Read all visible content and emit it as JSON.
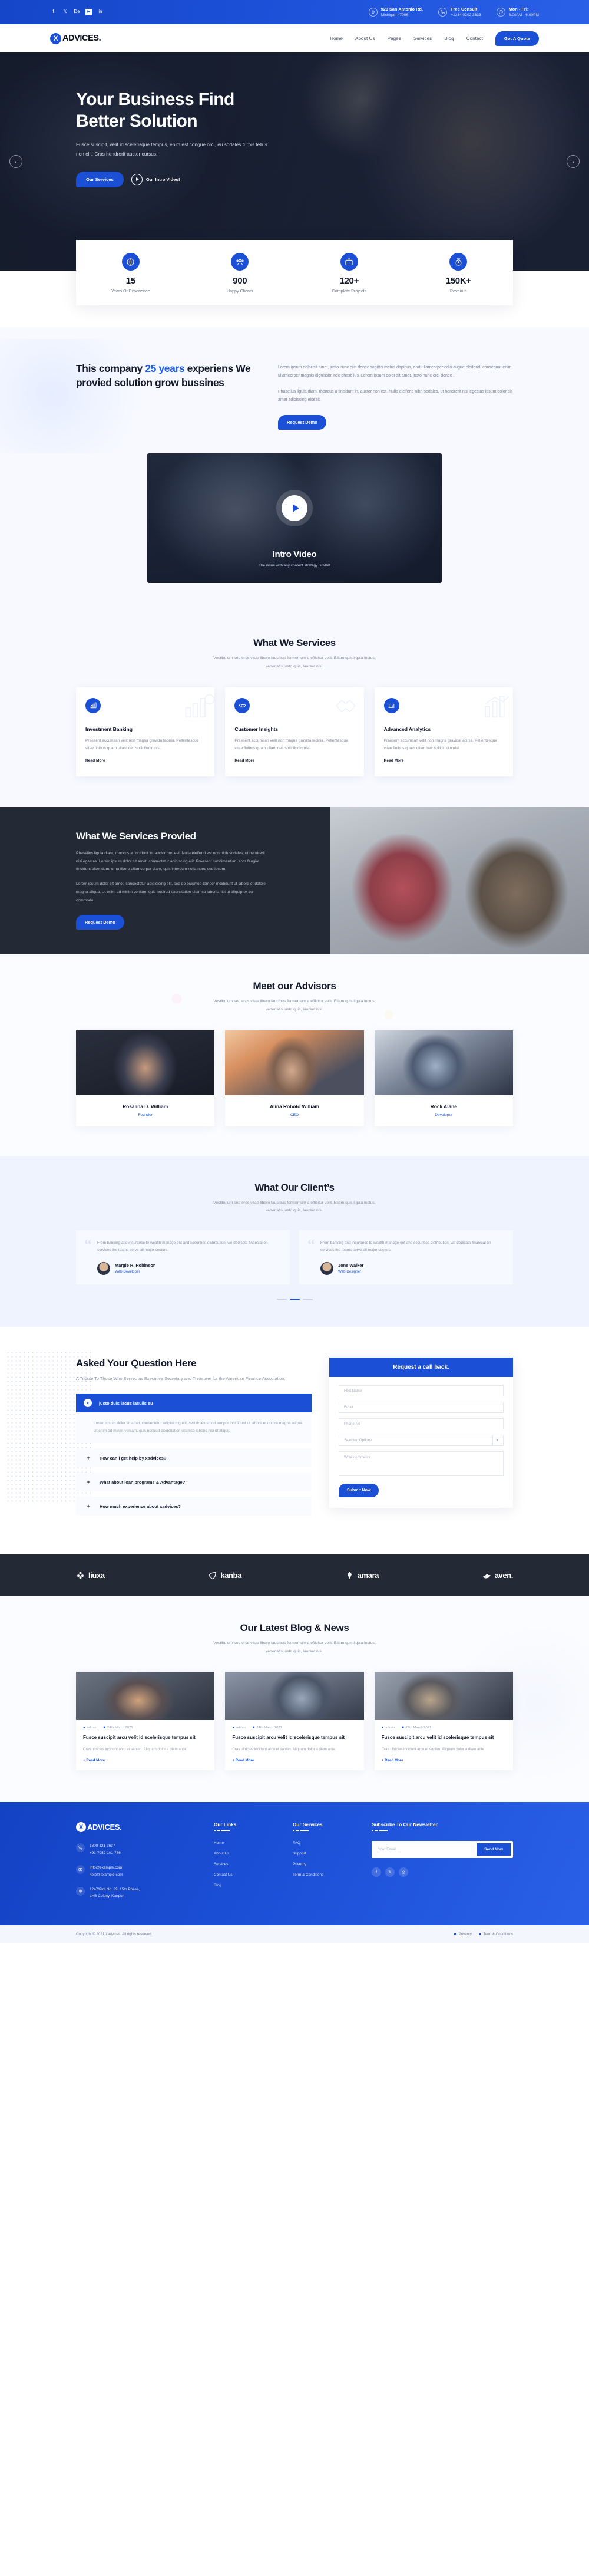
{
  "topbar": {
    "social": [
      "f",
      "t",
      "Dr",
      "yt",
      "in"
    ],
    "info": [
      {
        "icon": "location-pin-icon",
        "line1": "920 San Antonio Rd,",
        "line2": "Michigan 47096"
      },
      {
        "icon": "phone-icon",
        "line1": "Free Consult",
        "line2": "+1234 0202 3333"
      },
      {
        "icon": "clock-icon",
        "line1": "Mon - Fri:",
        "line2": "8:00AM - 6:00PM"
      }
    ]
  },
  "nav": {
    "logo_mark": "X",
    "logo_text": "ADVICES.",
    "items": [
      "Home",
      "About Us",
      "Pages",
      "Services",
      "Blog",
      "Contact"
    ],
    "cta": "Got A Quote"
  },
  "hero": {
    "title_line1": "Your Business Find",
    "title_line2": "Better Solution",
    "paragraph": "Fusce suscipit, velit id scelerisque tempus, enim est congue orci, eu sodales turpis tellus non elit. Cras hendrerit auctor cursus.",
    "primary_button": "Our Services",
    "video_label": "Our Intro Video!",
    "prev": "‹",
    "next": "›"
  },
  "stats": [
    {
      "icon": "globe-icon",
      "number": "15",
      "label": "Years Of Experience"
    },
    {
      "icon": "people-group-icon",
      "number": "900",
      "label": "Happy Clients"
    },
    {
      "icon": "briefcase-icon",
      "number": "120+",
      "label": "Complete Projects"
    },
    {
      "icon": "money-bag-icon",
      "number": "150K+",
      "label": "Revenue"
    }
  ],
  "about": {
    "title_pre": "This company ",
    "title_accent": "25 years",
    "title_post": " experiens We provied solution grow bussines",
    "p1": "Lorem ipsum dolor sit amet, justo nunc orci donec sagittis metus dapibus, erat ullamcorper odio augue eleifend, consequat enim ullamcorper magnis dignissim nec phasellus, Lorem ipsum dolor sit amet, justo nunc orci donec .",
    "p2": "Phasellus ligula diam, rhoncus a tincidunt in, auctor non est. Nulla eleifend nibh sodales, ut hendrerit nisi egestas ipsum dolor sit amet adipiscing elseait.",
    "button": "Request Demo"
  },
  "video": {
    "title": "Intro Video",
    "caption": "The issue with any content strategy is what",
    "play": "play-icon"
  },
  "services": {
    "heading": "What We Services",
    "sub": "Vestibulum sed eros vitae libero faucibus fermentum a efficitur velit. Etiam quis ligula luctus, venenatis justo quis, laoreet nisl.",
    "cards": [
      {
        "icon": "chart-money-icon",
        "title": "Investment Banking",
        "text": "Praesent accumsan velit non magna gravida lacinia. Pellentesque vitae finibus quam ullam nec sollicitudin nisi.",
        "link": "Read More"
      },
      {
        "icon": "handshake-icon",
        "title": "Customer Insights",
        "text": "Praesent accumsan velit non magna gravida lacinia. Pellentesque vitae finibus quam ullam nec sollicitudin nisi.",
        "link": "Read More"
      },
      {
        "icon": "bar-chart-icon",
        "title": "Advanced Analytics",
        "text": "Praesent accumsan velit non magna gravida lacinia. Pellentesque vitae finibus quam ullam nec sollicitudin nisi.",
        "link": "Read More"
      }
    ]
  },
  "provied": {
    "title": "What We Services Provied",
    "p1": "Phasellus ligula diam, rhoncus a tincidunt in, auctor non est. Nulla eleifend est non nibh sodales, ut hendrerit nisi egestas. Lorem ipsum dolor sit amet, consectetur adipiscing elit. Praesent condimentum, eros feugiat tincidunt bibendum, urna libero ullamcorper diam, quis interdum nulla nunc sed ipsum.",
    "p2": "Lorem ipsum dolor sit amet, consectetur adipisicing elit, sed do eiusmod tempor incididunt ut labore et dolore magna aliqua. Ut enim ad minim veniam, quis nostrud exercitation ullamco laboris nisi ut aliquip ex ea commodo.",
    "button": "Request Demo"
  },
  "advisors": {
    "heading": "Meet our Advisors",
    "sub": "Vestibulum sed eros vitae libero faucibus fermentum a efficitur velit. Etiam quis ligula luctus, venenatis justo quis, laoreet nisl.",
    "people": [
      {
        "name": "Rosalina D. William",
        "role": "Founder"
      },
      {
        "name": "Alina Roboto William",
        "role": "CEO"
      },
      {
        "name": "Rock Alane",
        "role": "Developer"
      }
    ]
  },
  "testimonials": {
    "heading": "What Our Client’s",
    "sub": "Vestibulum sed eros vitae libero faucibus fermentum a efficitur velit. Etiam quis ligula luctus, venenatis justo quis, laoreet nisl.",
    "items": [
      {
        "quote": "From banking and insurance to wealth manage ent and securities distribution, we dedicate financial on services the teams serve all major sectors.",
        "name": "Margie R. Robinson",
        "role": "Web Developer"
      },
      {
        "quote": "From banking and insurance to wealth manage ent and securities distribution, we dedicate financial on services the teams serve all major sectors.",
        "name": "Jone Walker",
        "role": "Web Designer"
      }
    ],
    "dots": 3,
    "active_dot": 1
  },
  "faq": {
    "heading": "Asked Your Question Here",
    "sub": "A Tribute To Those Who Served as Executive Secretary and Treasurer for the American Finance Association.",
    "open": {
      "icon": "close-icon",
      "title": "justo duis lacus iaculis eu",
      "body": "Lorem ipsum dolor sit amet, consectetur adipisicing elit, sed do eiusmod tempor incididunt ut labore et dolore magna aliqua. Ut enim ad minim veniam, quis nostrud exercitation ullamco laboris nisi ut aliquip"
    },
    "closed": [
      {
        "icon": "plus-icon",
        "title": "How can i get help by xadvices?"
      },
      {
        "icon": "plus-icon",
        "title": "What about loan programs & Advantage?"
      },
      {
        "icon": "plus-icon",
        "title": "How much experience about xadvices?"
      }
    ]
  },
  "callback": {
    "title": "Request a call back.",
    "fields": [
      {
        "name": "name-field",
        "placeholder": "First Name"
      },
      {
        "name": "email-field",
        "placeholder": "Email"
      },
      {
        "name": "phone-field",
        "placeholder": "Phone No"
      }
    ],
    "select": {
      "value": "Selected Options",
      "caret": "▾"
    },
    "textarea": {
      "placeholder": "Write comments"
    },
    "submit": "Submit Now"
  },
  "brands": [
    {
      "icon": "flower-icon",
      "name": "liuxa"
    },
    {
      "icon": "leaf-icon",
      "name": "kanba"
    },
    {
      "icon": "diamond-icon",
      "name": "amara"
    },
    {
      "icon": "bird-icon",
      "name": "aven."
    }
  ],
  "blog": {
    "heading": "Our Latest Blog & News",
    "sub": "Vestibulum sed eros vitae libero faucibus fermentum a efficitur velit. Etiam quis ligula luctus, venenatis justo quis, laoreet nisl.",
    "posts": [
      {
        "author": "admin",
        "date": "24th March 2021",
        "title": "Fusce suscipit arcu velit id scelerisque tempus sit",
        "text": "Cras ultricies incidunt arcu et sapien. Aliquam dolor a diam ante.",
        "link": "+ Read More"
      },
      {
        "author": "admin",
        "date": "24th March 2021",
        "title": "Fusce suscipit arcu velit id scelerisque tempus sit",
        "text": "Cras ultricies incidunt arcu et sapien. Aliquam dolor a diam ante.",
        "link": "+ Read More"
      },
      {
        "author": "admin",
        "date": "24th March 2021",
        "title": "Fusce suscipit arcu velit id scelerisque tempus sit",
        "text": "Cras ultricies incidunt arcu et sapien. Aliquam dolor a diam ante.",
        "link": "+ Read More"
      }
    ]
  },
  "footer": {
    "logo_mark": "X",
    "logo_text": "ADVICES.",
    "contacts": [
      {
        "icon": "phone-icon",
        "l1": "1800-121-3637",
        "l2": "+91-7052-101-786"
      },
      {
        "icon": "mail-icon",
        "l1": "Info@example.com",
        "l2": "help@example.com"
      },
      {
        "icon": "location-pin-icon",
        "l1": "1247/Plot No. 39, 15th Phase,",
        "l2": "LHB Colony, Kanpur"
      }
    ],
    "links_title": "Our Links",
    "links": [
      "Home",
      "About Us",
      "Services",
      "Contact Us",
      "Blog"
    ],
    "services_title": "Our Services",
    "services": [
      "FAQ",
      "Support",
      "Privercy",
      "Term & Conditions"
    ],
    "newsletter_title": "Subscribe To Our Newsletter",
    "newsletter_placeholder": "Your Email...",
    "newsletter_button": "Send Now",
    "social": [
      "f",
      "t",
      "ig"
    ]
  },
  "copyright": {
    "text": "Copyright © 2021 Xadvices. All rights reserved.",
    "links": [
      "Privercy",
      "Term & Conditions"
    ]
  }
}
